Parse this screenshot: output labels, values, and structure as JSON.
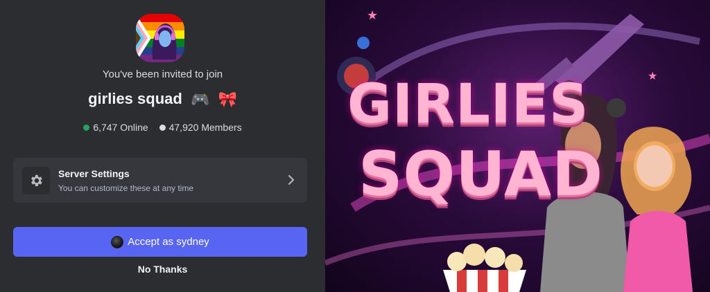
{
  "invite": {
    "subtitle": "You've been invited to join",
    "server_name": "girlies squad",
    "emoji_1": "🎮",
    "emoji_2": "🎀",
    "online_count": "6,747 Online",
    "member_count": "47,920 Members"
  },
  "settings": {
    "title": "Server Settings",
    "subtitle": "You can customize these at any time"
  },
  "actions": {
    "accept_label": "Accept as sydney",
    "decline_label": "No Thanks"
  },
  "banner": {
    "line1": "GIRLIES",
    "line2": "SQUAD"
  },
  "colors": {
    "primary_button": "#5865f2",
    "online_dot": "#23a55a",
    "panel_bg": "#2b2d31",
    "card_bg": "#35373c"
  }
}
